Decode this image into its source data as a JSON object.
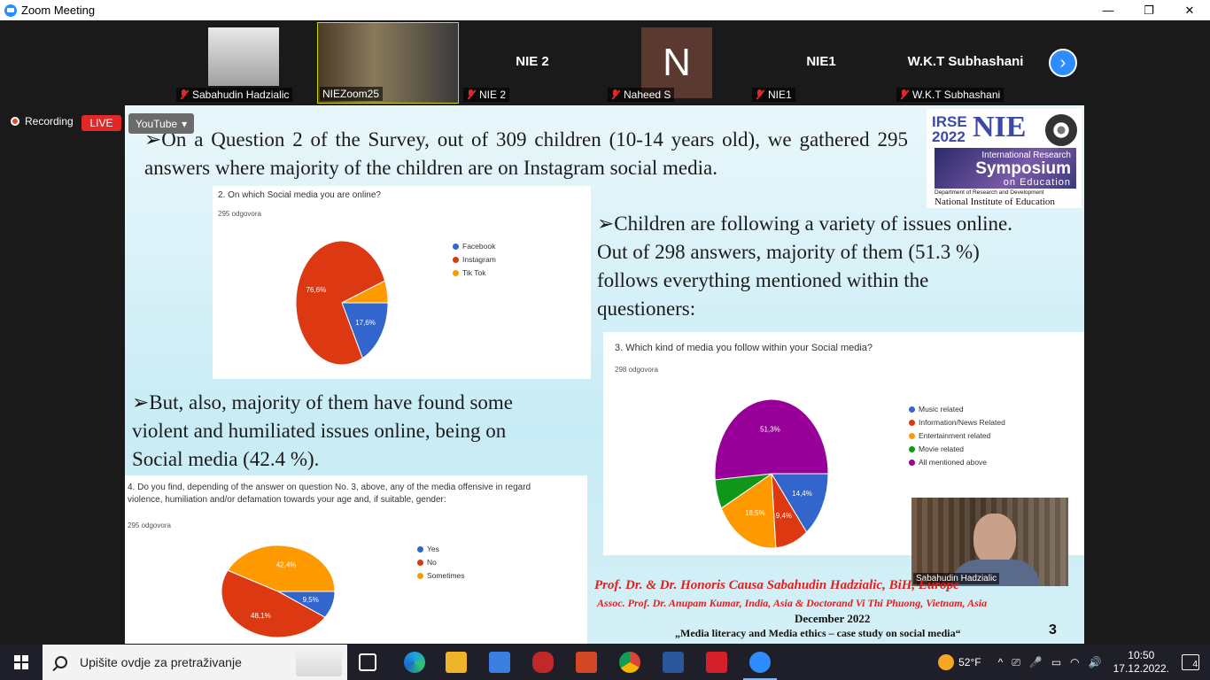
{
  "window": {
    "title": "Zoom Meeting",
    "controls": [
      "—",
      "❐",
      "✕"
    ]
  },
  "participants": [
    {
      "label": "Sabahudin Hadzialic",
      "muted": true
    },
    {
      "label": "NIEZoom25",
      "muted": false
    },
    {
      "label": "NIE 2",
      "big": "NIE 2",
      "muted": true
    },
    {
      "label": "Naheed S",
      "big": "N",
      "muted": true
    },
    {
      "label": "NIE1",
      "big": "NIE1",
      "muted": true
    },
    {
      "label": "W.K.T Subhashani",
      "big": "W.K.T Subhashani",
      "muted": true
    }
  ],
  "next_icon": "›",
  "recording": {
    "label": "Recording",
    "live": "LIVE",
    "youtube": "YouTube",
    "caret": "▾"
  },
  "slide": {
    "para1": "➢On a Question 2 of the Survey, out of 309 children (10-14 years old), we gathered 295 answers where majority of the children are on Instagram social media.",
    "para2": "➢Children are following a variety of issues online. Out of 298 answers, majority of them (51.3 %) follows everything mentioned within the questioners:",
    "para3": "➢But, also, majority of them have found some violent and humiliated issues online, being on Social media (42.4 %).",
    "logo": {
      "irse": "IRSE",
      "year": "2022",
      "nie": "NIE",
      "l1": "International Research",
      "l2": "Symposium",
      "l3": "on Education",
      "dept": "Department of Research and Development",
      "inst": "National Institute of Education"
    },
    "chart1": {
      "title": "2. On which Social media you are online?",
      "sub": "295 odgovora"
    },
    "chart2": {
      "title": "3. Which kind of media you follow within your Social media?",
      "sub": "298 odgovora"
    },
    "chart3": {
      "title": "4. Do you find, depending of the answer on question No. 3, above, any of the media offensive in regard violence, humiliation and/or defamation towards your age and, if suitable, gender:",
      "sub": "295 odgovora"
    },
    "footer": {
      "line1": "Prof. Dr. & Dr. Honoris Causa Sabahudin Hadzialic, BiH, Europe",
      "line2": "Assoc. Prof. Dr. Anupam Kumar, India, Asia & Doctorand Vi Thi Phuong, Vietnam, Asia",
      "line3": "December 2022",
      "line4": "„Media literacy and Media ethics – case study on social media“",
      "page": "3"
    },
    "selfview_label": "Sabahudin Hadzialic"
  },
  "chart_data": [
    {
      "type": "pie",
      "title": "2. On which Social media you are online?",
      "categories": [
        "Facebook",
        "Instagram",
        "Tik Tok"
      ],
      "values": [
        17.6,
        76.6,
        5.8
      ],
      "labels": [
        "17,6%",
        "76,6%",
        ""
      ],
      "colors": [
        "#3366cc",
        "#dc3912",
        "#ff9900"
      ]
    },
    {
      "type": "pie",
      "title": "3. Which kind of media you follow within your Social media?",
      "categories": [
        "Music related",
        "Information/News Related",
        "Entertainment related",
        "Movie related",
        "All mentioned above"
      ],
      "values": [
        14.4,
        9.4,
        18.5,
        6.4,
        51.3
      ],
      "labels": [
        "14,4%",
        "9,4%",
        "18,5%",
        "",
        "51,3%"
      ],
      "colors": [
        "#3366cc",
        "#dc3912",
        "#ff9900",
        "#109618",
        "#990099"
      ]
    },
    {
      "type": "pie",
      "title": "4. Do you find, depending of the answer on question No. 3, above, any of the media offensive in regard violence, humiliation and/or defamation towards your age and, if suitable, gender:",
      "categories": [
        "Yes",
        "No",
        "Sometimes"
      ],
      "values": [
        9.5,
        48.1,
        42.4
      ],
      "labels": [
        "9,5%",
        "48,1%",
        "42,4%"
      ],
      "colors": [
        "#3366cc",
        "#dc3912",
        "#ff9900"
      ]
    }
  ],
  "taskbar": {
    "search_placeholder": "Upišite ovdje za pretraživanje",
    "weather": "52°F",
    "time": "10:50",
    "date": "17.12.2022.",
    "notifications": "4",
    "tray_icons": [
      "^",
      "⎚",
      "🎤",
      "▭",
      "◠",
      "🔊"
    ]
  }
}
